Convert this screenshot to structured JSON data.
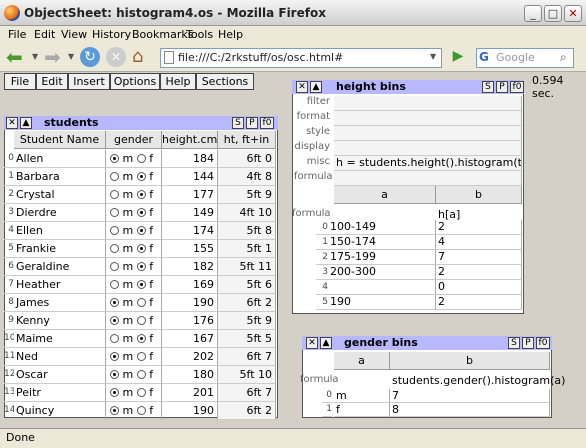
{
  "window": {
    "title": "ObjectSheet: histogram4.os - Mozilla Firefox"
  },
  "menubar": [
    "File",
    "Edit",
    "View",
    "History",
    "Bookmarks",
    "Tools",
    "Help"
  ],
  "address": {
    "url": "file:///C:/2rkstuff/os/osc.html#"
  },
  "search": {
    "placeholder": "Google"
  },
  "os_toolbar": [
    "File",
    "Edit",
    "Insert",
    "Options",
    "Help",
    "Sections"
  ],
  "timing": "0.594 sec.",
  "students": {
    "title": "students",
    "buttons": [
      "S",
      "P",
      "f0"
    ],
    "columns": [
      "Student Name",
      "gender",
      "height.cm",
      "ht, ft+in"
    ],
    "rows": [
      {
        "idx": "0",
        "name": "Allen",
        "g": "m",
        "height": "184",
        "ft": "6ft 0"
      },
      {
        "idx": "1",
        "name": "Barbara",
        "g": "f",
        "height": "144",
        "ft": "4ft 8"
      },
      {
        "idx": "2",
        "name": "Crystal",
        "g": "f",
        "height": "177",
        "ft": "5ft 9"
      },
      {
        "idx": "3",
        "name": "Dierdre",
        "g": "f",
        "height": "149",
        "ft": "4ft 10"
      },
      {
        "idx": "4",
        "name": "Ellen",
        "g": "f",
        "height": "174",
        "ft": "5ft 8"
      },
      {
        "idx": "5",
        "name": "Frankie",
        "g": "f",
        "height": "155",
        "ft": "5ft 1"
      },
      {
        "idx": "6",
        "name": "Geraldine",
        "g": "f",
        "height": "182",
        "ft": "5ft 11"
      },
      {
        "idx": "7",
        "name": "Heather",
        "g": "f",
        "height": "169",
        "ft": "5ft 6"
      },
      {
        "idx": "8",
        "name": "James",
        "g": "m",
        "height": "190",
        "ft": "6ft 2"
      },
      {
        "idx": "9",
        "name": "Kenny",
        "g": "m",
        "height": "176",
        "ft": "5ft 9"
      },
      {
        "idx": "10",
        "name": "Maime",
        "g": "f",
        "height": "167",
        "ft": "5ft 5"
      },
      {
        "idx": "11",
        "name": "Ned",
        "g": "m",
        "height": "202",
        "ft": "6ft 7"
      },
      {
        "idx": "12",
        "name": "Oscar",
        "g": "m",
        "height": "180",
        "ft": "5ft 10"
      },
      {
        "idx": "13",
        "name": "Peitr",
        "g": "m",
        "height": "201",
        "ft": "6ft 7"
      },
      {
        "idx": "14",
        "name": "Quincy",
        "g": "m",
        "height": "190",
        "ft": "6ft 2"
      }
    ]
  },
  "height_bins": {
    "title": "height bins",
    "buttons": [
      "S",
      "P",
      "f0"
    ],
    "props": [
      {
        "label": "filter",
        "value": ""
      },
      {
        "label": "format",
        "value": ""
      },
      {
        "label": "style",
        "value": ""
      },
      {
        "label": "display",
        "value": ""
      },
      {
        "label": "misc",
        "value": "h = students.height().histogram(this.a());"
      },
      {
        "label": "formula",
        "value": ""
      }
    ],
    "columns": [
      "a",
      "b"
    ],
    "formula_label": "formula",
    "formula_b": "h[a]",
    "rows": [
      {
        "idx": "0",
        "a": "100-149",
        "b": "2"
      },
      {
        "idx": "1",
        "a": "150-174",
        "b": "4"
      },
      {
        "idx": "2",
        "a": "175-199",
        "b": "7"
      },
      {
        "idx": "3",
        "a": "200-300",
        "b": "2"
      },
      {
        "idx": "4",
        "a": "",
        "b": "0"
      },
      {
        "idx": "5",
        "a": "190",
        "b": "2"
      }
    ]
  },
  "gender_bins": {
    "title": "gender bins",
    "buttons": [
      "S",
      "P",
      "f0"
    ],
    "columns": [
      "a",
      "b"
    ],
    "formula_label": "formula",
    "formula_b": "students.gender().histogram(a)",
    "rows": [
      {
        "idx": "0",
        "a": "m",
        "b": "7"
      },
      {
        "idx": "1",
        "a": "f",
        "b": "8"
      }
    ]
  },
  "status": "Done"
}
